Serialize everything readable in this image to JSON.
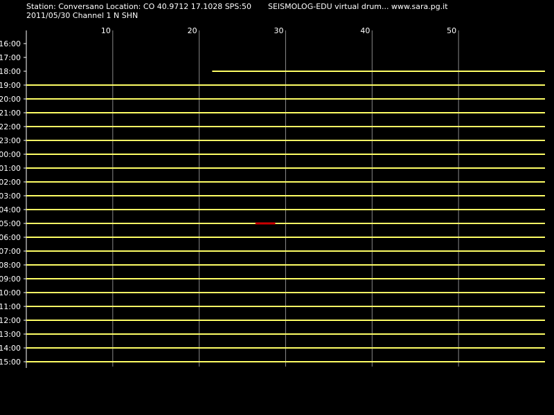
{
  "header": {
    "station_line": "Station: Conversano Location: CO 40.9712 17.1028 SPS:50",
    "date_channel": "2011/05/30  Channel 1 N SHN",
    "app_title": "SEISMOLOG-EDU virtual drum... www.sara.pg.it"
  },
  "colors": {
    "background": "#000000",
    "trace": "#ffff66",
    "event": "#cc0000",
    "grid": "#888888",
    "text": "#ffffff"
  },
  "drum": {
    "minute_ticks": [
      "10",
      "20",
      "30",
      "40",
      "50"
    ],
    "hours": [
      "16:00",
      "17:00",
      "18:00",
      "19:00",
      "20:00",
      "21:00",
      "22:00",
      "23:00",
      "00:00",
      "01:00",
      "02:00",
      "03:00",
      "04:00",
      "05:00",
      "06:00",
      "07:00",
      "08:00",
      "09:00",
      "10:00",
      "11:00",
      "12:00",
      "13:00",
      "14:00",
      "15:00"
    ],
    "trace_start_minute": [
      60,
      60,
      21.5,
      0,
      0,
      0,
      0,
      0,
      0,
      0,
      0,
      0,
      0,
      0,
      0,
      0,
      0,
      0,
      0,
      0,
      0,
      0,
      0,
      0
    ],
    "event": {
      "hour": "05:00",
      "start_minute": 26.5,
      "end_minute": 28.8
    }
  }
}
